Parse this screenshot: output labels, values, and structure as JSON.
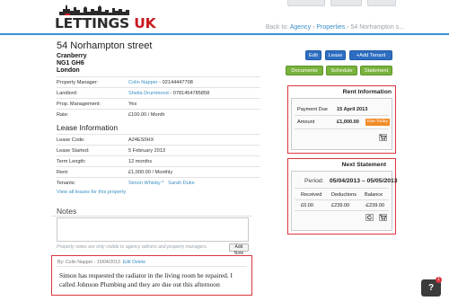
{
  "header": {
    "logo": {
      "part1": "LETTINGS",
      "part2": "UK"
    },
    "breadcrumb": {
      "prefix": "Back to: ",
      "link1": "Agency",
      "sep1": " › ",
      "link2": "Properties",
      "sep2": " › ",
      "current": "54 Norhampton s..."
    }
  },
  "property": {
    "title": "54 Norhampton street",
    "address": [
      "Cranberry",
      "NG1 GH6",
      "London"
    ]
  },
  "actions": {
    "row1": [
      "Edit",
      "Lease",
      "+Add Tenant"
    ],
    "row2": [
      "Documents",
      "Schedule",
      "Statement"
    ]
  },
  "details": [
    {
      "key": "Property Manager:",
      "value": "Colin Napper",
      "extra": " - 02144447708",
      "link": true
    },
    {
      "key": "Landlord:",
      "value": "Sheila Drummond",
      "extra": " - 0781454785858",
      "link": true
    },
    {
      "key": "Prop. Management:",
      "value": "Yes",
      "extra": "",
      "link": false
    },
    {
      "key": "Rate:",
      "value": "£100.00 / Month",
      "extra": "",
      "link": false
    }
  ],
  "lease": {
    "heading": "Lease Information",
    "rows": [
      {
        "key": "Lease Code:",
        "value": "A24ES0HX"
      },
      {
        "key": "Lease Started:",
        "value": "5 February 2013"
      },
      {
        "key": "Term Length:",
        "value": "12 months"
      },
      {
        "key": "Rent:",
        "value": "£1,000.00 / Monthly"
      },
      {
        "key": "Tenants:",
        "value": "Simon Whisby *",
        "value2": "Sarah Duke"
      }
    ],
    "view_all": "View all leases for this property"
  },
  "rent_info": {
    "title": "Rent Information",
    "due_label": "Payment Due",
    "due_value": "15 April 2013",
    "amount_label": "Amount",
    "amount_value": "£1,000.00",
    "due_badge": "Due Today"
  },
  "next_statement": {
    "title": "Next Statement",
    "period_label": "Period:",
    "period_value": "05/04/2013 – 05/05/2013",
    "columns": [
      "Received",
      "Deductions",
      "Balance"
    ],
    "values": [
      "£0.00",
      "£239.00",
      "-£239.00"
    ]
  },
  "notes": {
    "heading": "Notes",
    "hint": "Property notes are only visible to agency admins and property managers.",
    "add_label": "Add Note",
    "entry": {
      "meta_prefix": "By: ",
      "author": "Colin Napper",
      "date": " - 15/04/2013",
      "edit": "Edit",
      "delete": "Delete",
      "text": "Simon has requested the radiator in the living room be repaired. I called Johnson Plumbing and they are due out this afternoon"
    }
  },
  "help": {
    "label": "?",
    "badge": "1"
  },
  "colors": {
    "accent": "#3f8fcf",
    "brand_red": "#c8191e",
    "green": "#79b23d",
    "blue": "#2e6ec2",
    "highlight": "#d9363e"
  }
}
